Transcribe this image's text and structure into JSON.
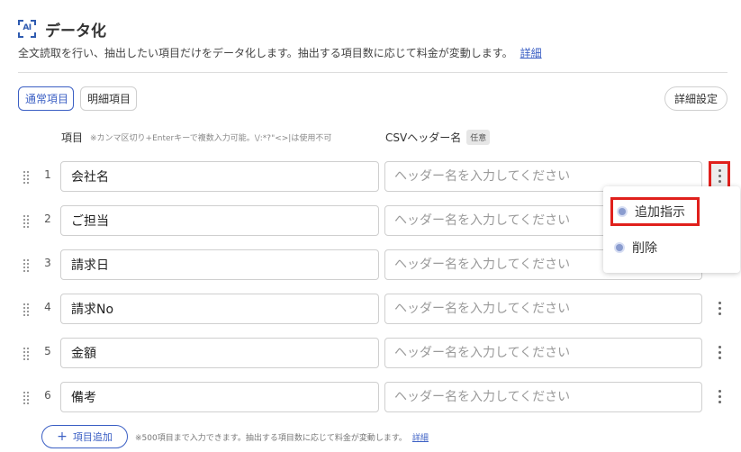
{
  "header": {
    "icon_text": "AI",
    "title": "データ化",
    "description": "全文読取を行い、抽出したい項目だけをデータ化します。抽出する項目数に応じて料金が変動します。",
    "description_link": "詳細"
  },
  "tabs": [
    {
      "label": "通常項目",
      "active": true
    },
    {
      "label": "明細項目",
      "active": false
    }
  ],
  "detail_settings_label": "詳細設定",
  "columns": {
    "item_label": "項目",
    "item_note": "※カンマ区切り+Enterキーで複数入力可能。\\/:*?\"<>|は使用不可",
    "csv_label": "CSVヘッダー名",
    "csv_badge": "任意"
  },
  "rows": [
    {
      "num": "1",
      "name": "会社名",
      "header_value": "",
      "header_placeholder": "ヘッダー名を入力してください"
    },
    {
      "num": "2",
      "name": "ご担当",
      "header_value": "",
      "header_placeholder": "ヘッダー名を入力してください"
    },
    {
      "num": "3",
      "name": "請求日",
      "header_value": "",
      "header_placeholder": "ヘッダー名を入力してください"
    },
    {
      "num": "4",
      "name": "請求No",
      "header_value": "",
      "header_placeholder": "ヘッダー名を入力してください"
    },
    {
      "num": "5",
      "name": "金額",
      "header_value": "",
      "header_placeholder": "ヘッダー名を入力してください"
    },
    {
      "num": "6",
      "name": "備考",
      "header_value": "",
      "header_placeholder": "ヘッダー名を入力してください"
    }
  ],
  "context_menu": {
    "items": [
      {
        "label": "追加指示"
      },
      {
        "label": "削除"
      }
    ]
  },
  "footer": {
    "add_button_icon": "+",
    "add_button_label": "項目追加",
    "note": "※500項目まで入力できます。抽出する項目数に応じて料金が変動します。",
    "note_link": "詳細"
  },
  "colors": {
    "accent": "#3b5fc4",
    "highlight": "#e0201c"
  }
}
